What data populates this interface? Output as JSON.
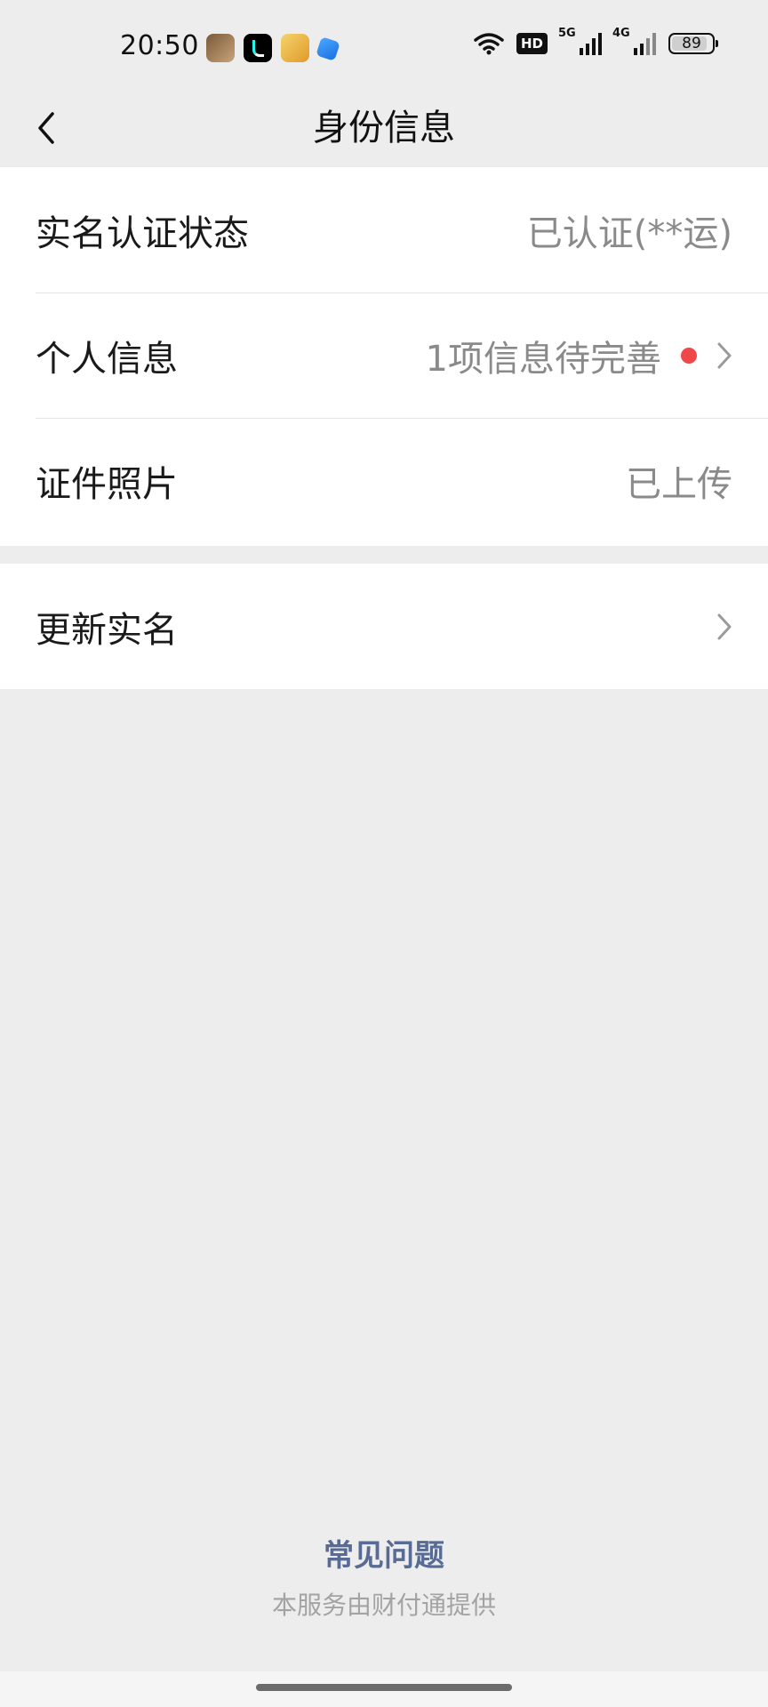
{
  "status_bar": {
    "time": "20:50",
    "notification_icons": [
      "pubg-app-icon",
      "tiktok-app-icon",
      "game-app-icon",
      "blue-app-icon"
    ],
    "hd_label": "HD",
    "signal_1_label": "5G",
    "signal_2_label": "4G",
    "battery_percent": "89",
    "battery_level": 0.89
  },
  "nav": {
    "title": "身份信息",
    "back_icon": "chevron-left-icon"
  },
  "group_1": {
    "rows": [
      {
        "label": "实名认证状态",
        "value": "已认证(**运)"
      },
      {
        "label": "个人信息",
        "value": "1项信息待完善",
        "has_red_dot": true,
        "has_chevron": true
      },
      {
        "label": "证件照片",
        "value": "已上传"
      }
    ]
  },
  "group_2": {
    "rows": [
      {
        "label": "更新实名",
        "has_chevron": true
      }
    ]
  },
  "footer": {
    "faq_label": "常见问题",
    "provider_note": "本服务由财付通提供"
  },
  "colors": {
    "background": "#ededed",
    "card": "#ffffff",
    "red_dot": "#f04848",
    "link": "#586b94",
    "muted_text": "#8a8a8a"
  }
}
